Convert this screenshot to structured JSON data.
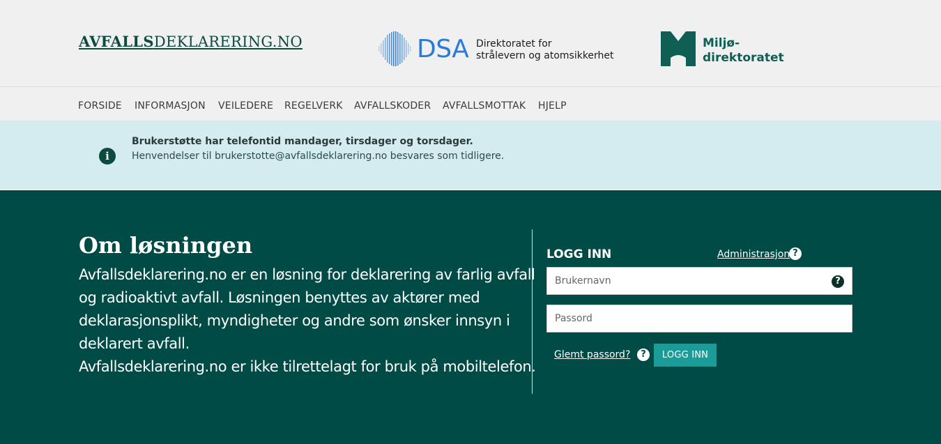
{
  "header": {
    "site_logo": {
      "bold": "AVFALLS",
      "rest": "DEKLARERING.NO"
    },
    "dsa": {
      "word": "DSA",
      "line1": "Direktoratet for",
      "line2": "strålevern og atomsikkerhet"
    },
    "miljo": {
      "line1": "Miljø-",
      "line2": "direktoratet"
    }
  },
  "nav": {
    "items": [
      {
        "label": "FORSIDE"
      },
      {
        "label": "INFORMASJON"
      },
      {
        "label": "VEILEDERE"
      },
      {
        "label": "REGELVERK"
      },
      {
        "label": "AVFALLSKODER"
      },
      {
        "label": "AVFALLSMOTTAK"
      },
      {
        "label": "HJELP"
      }
    ]
  },
  "banner": {
    "icon": "info-icon",
    "title": "Brukerstøtte har telefontid mandager, tirsdager og torsdager.",
    "text": "Henvendelser til brukerstotte@avfallsdeklarering.no besvares som tidligere."
  },
  "about": {
    "title": "Om løsningen",
    "lines": [
      "Avfallsdeklarering.no er en løsning for deklarering av farlig avfall",
      "og radioaktivt avfall. Løsningen benyttes av aktører med",
      "deklarasjonsplikt, myndigheter og andre som ønsker innsyn i",
      "deklarert avfall.",
      "Avfallsdeklarering.no er ikke tilrettelagt for bruk på mobiltelefon."
    ]
  },
  "login": {
    "title": "LOGG INN",
    "admin_link": "Administrasjon",
    "username_placeholder": "Brukernavn",
    "password_placeholder": "Passord",
    "forgot_link": "Glemt passord?",
    "submit_label": "LOGG INN",
    "help_glyph": "?"
  },
  "colors": {
    "primary_dark": "#014b46",
    "banner_bg": "#d4ecef",
    "button": "#1a9c99",
    "dsa_blue": "#2b7bd8"
  }
}
